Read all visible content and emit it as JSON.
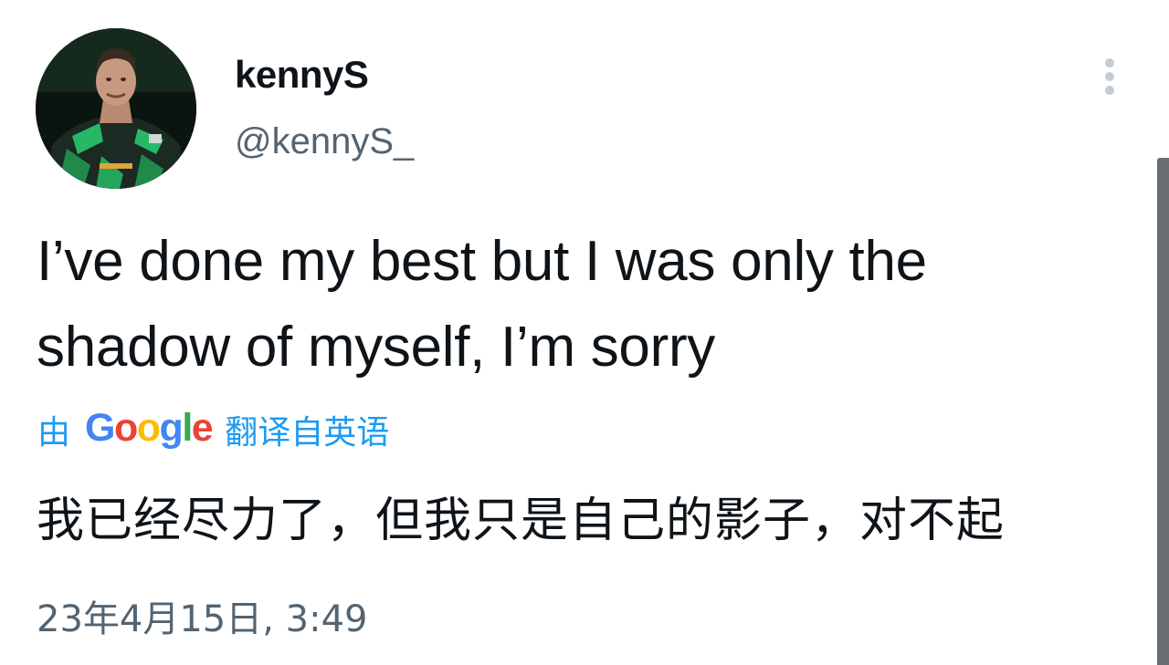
{
  "author": {
    "display_name": "kennyS",
    "handle": "@kennyS_"
  },
  "tweet": {
    "text": "I’ve done my best but I was only the shadow of myself, I’m sorry",
    "translation": {
      "prefix": "由",
      "provider": [
        "G",
        "o",
        "o",
        "g",
        "l",
        "e"
      ],
      "provider_colors": [
        "#4285F4",
        "#EA4335",
        "#FBBC05",
        "#4285F4",
        "#34A853",
        "#EA4335"
      ],
      "suffix": "翻译自英语",
      "text": "我已经尽力了，但我只是自己的影子，对不起"
    },
    "timestamp": "23年4月15日, 3:49"
  },
  "icons": {
    "more": "more-vertical-icon"
  },
  "colors": {
    "link_blue": "#1d9bf0",
    "secondary_text": "#536471",
    "primary_text": "#0f1419"
  }
}
